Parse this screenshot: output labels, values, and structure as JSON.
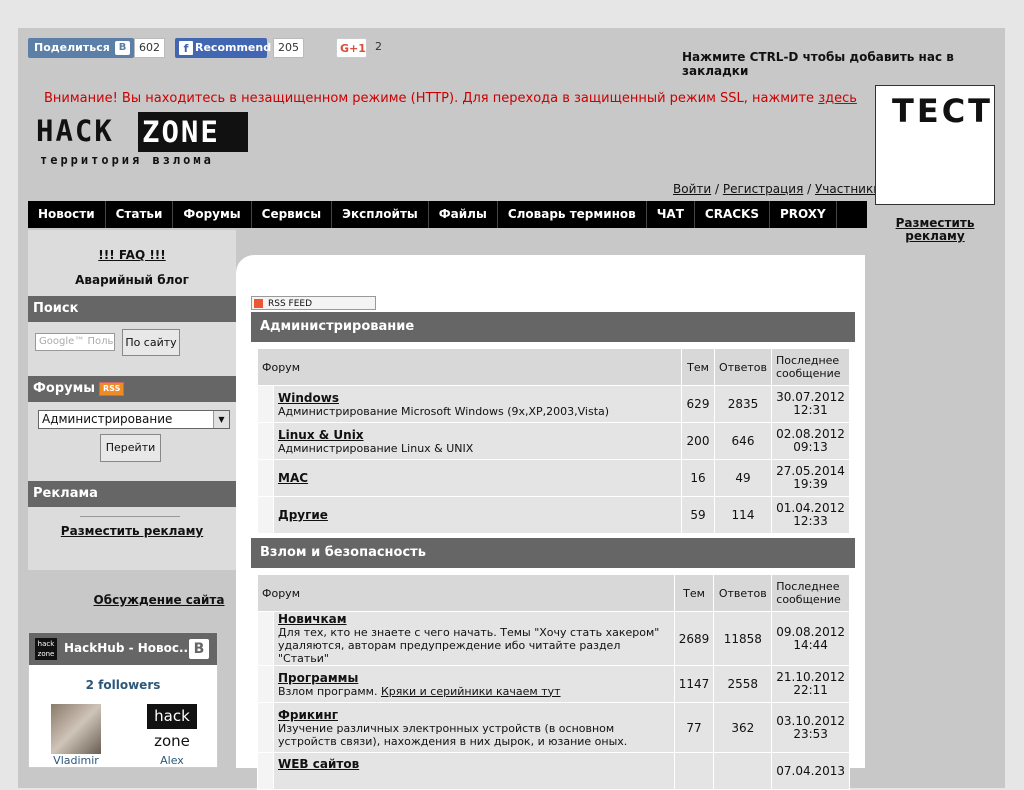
{
  "social": {
    "vk_label": "Поделиться",
    "vk_logo": "B",
    "vk_count": "602",
    "fb_logo": "f",
    "fb_label": "Recommend",
    "fb_count": "205",
    "gplus_label": "G+1",
    "gplus_count": "2"
  },
  "bookmark_hint": "Нажмите CTRL-D чтобы добавить нас в закладки",
  "ssl_notice": {
    "text": "Внимание! Вы находитесь в незащищенном режиме (HTTP). Для перехода в защищенный режим SSL, нажмите ",
    "link": "здесь"
  },
  "logo": {
    "hack": "HACK",
    "zone": "ZONE",
    "tagline": "территория взлома"
  },
  "auth": {
    "login": "Войти",
    "sep1": " / ",
    "register": "Регистрация",
    "sep2": " / ",
    "members": "Участники"
  },
  "nav": [
    "Новости",
    "Статьи",
    "Форумы",
    "Сервисы",
    "Эксплойты",
    "Файлы",
    "Словарь терминов",
    "ЧАТ",
    "CRACKS",
    "PROXY"
  ],
  "side_ad": {
    "title": "ТЕСТ",
    "link": "Разместить рекламу"
  },
  "sidebar": {
    "faq": "!!! FAQ !!!",
    "blog": "Аварийный блог",
    "search_title": "Поиск",
    "search_placeholder": "Google™ Поль",
    "search_button": "По сайту",
    "forums_title": "Форумы",
    "rss_badge": "RSS",
    "forum_select": "Администрирование",
    "go_button": "Перейти",
    "ads_title": "Реклама",
    "ads_link": "Разместить рекламу",
    "discuss": "Обсуждение сайта"
  },
  "vk_widget": {
    "logo_top": "hack",
    "logo_bottom": "zone",
    "title": "HackHub - Новос...",
    "b": "B",
    "followers": "2 followers",
    "members": [
      {
        "name": "Vladimir"
      },
      {
        "name": "Alex",
        "avatar_top": "hack",
        "avatar_bottom": "zone"
      }
    ]
  },
  "rss_feed": "RSS FEED",
  "sections": [
    {
      "title": "Администрирование",
      "headers": {
        "forum": "Форум",
        "topics": "Тем",
        "replies": "Ответов",
        "last": "Последнее сообщение"
      },
      "rows": [
        {
          "name": "Windows",
          "desc": "Администрирование Microsoft Windows (9x,XP,2003,Vista)",
          "topics": "629",
          "replies": "2835",
          "date": "30.07.2012",
          "time": "12:31"
        },
        {
          "name": "Linux & Unix",
          "desc": "Администрирование Linux & UNIX",
          "topics": "200",
          "replies": "646",
          "date": "02.08.2012",
          "time": "09:13"
        },
        {
          "name": "MAC",
          "desc": "",
          "topics": "16",
          "replies": "49",
          "date": "27.05.2014",
          "time": "19:39"
        },
        {
          "name": "Другие",
          "desc": "",
          "topics": "59",
          "replies": "114",
          "date": "01.04.2012",
          "time": "12:33"
        }
      ]
    },
    {
      "title": "Взлом и безопасность",
      "headers": {
        "forum": "Форум",
        "topics": "Тем",
        "replies": "Ответов",
        "last": "Последнее сообщение"
      },
      "rows": [
        {
          "name": "Новичкам",
          "desc": "Для тех, кто не знаете с чего начать. Темы \"Хочу стать хакером\" удаляются, авторам предупреждение ибо читайте раздел \"Статьи\"",
          "topics": "2689",
          "replies": "11858",
          "date": "09.08.2012",
          "time": "14:44"
        },
        {
          "name": "Программы",
          "desc": "Взлом программ. ",
          "desc_link": "Кряки и серийники качаем тут",
          "topics": "1147",
          "replies": "2558",
          "date": "21.10.2012",
          "time": "22:11"
        },
        {
          "name": "Фрикинг",
          "desc": "Изучение различных электронных устройств (в основном устройств связи), нахождения в них дырок, и юзание оных.",
          "topics": "77",
          "replies": "362",
          "date": "03.10.2012",
          "time": "23:53"
        },
        {
          "name": "WEB сайтов",
          "desc": "",
          "topics": "",
          "replies": "",
          "date": "07.04.2013",
          "time": ""
        }
      ]
    }
  ]
}
